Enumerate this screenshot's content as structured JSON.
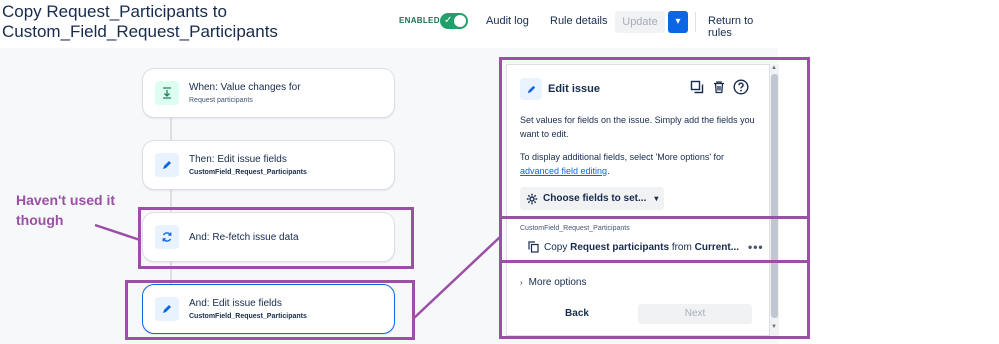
{
  "header": {
    "title_line1": "Copy Request_Participants to",
    "title_line2": "Custom_Field_Request_Participants",
    "enabled_label": "ENABLED",
    "audit_log": "Audit log",
    "rule_details": "Rule details",
    "update": "Update",
    "return_to_rules": "Return to rules"
  },
  "rule_steps": [
    {
      "title": "When: Value changes for",
      "subtitle": "Request participants",
      "icon": "field-change-icon"
    },
    {
      "title": "Then: Edit issue fields",
      "subtitle": "CustomField_Request_Participants",
      "icon": "pencil-icon"
    },
    {
      "title": "And: Re-fetch issue data",
      "subtitle": "",
      "icon": "refresh-icon"
    },
    {
      "title": "And: Edit issue fields",
      "subtitle": "CustomField_Request_Participants",
      "icon": "pencil-icon"
    }
  ],
  "annotation": {
    "text_line1": "Haven't used it",
    "text_line2": "though",
    "color": "#9b4fa6"
  },
  "panel": {
    "title": "Edit issue",
    "desc": "Set values for fields on the issue. Simply add the fields you want to edit.",
    "desc2_prefix": "To display additional fields, select 'More options' for ",
    "desc2_link": "advanced field editing",
    "desc2_suffix": ".",
    "choose_fields": "Choose fields to set...",
    "field_label": "CustomField_Request_Participants",
    "field_copy": "Copy ",
    "field_copy_bold1": "Request participants",
    "field_copy_from": " from ",
    "field_copy_bold2": "Current...",
    "more_options": "More options",
    "back": "Back",
    "next": "Next"
  },
  "colors": {
    "accent": "#0c66e4",
    "toggle_on": "#22a06b",
    "annotation": "#9b4fa6"
  }
}
